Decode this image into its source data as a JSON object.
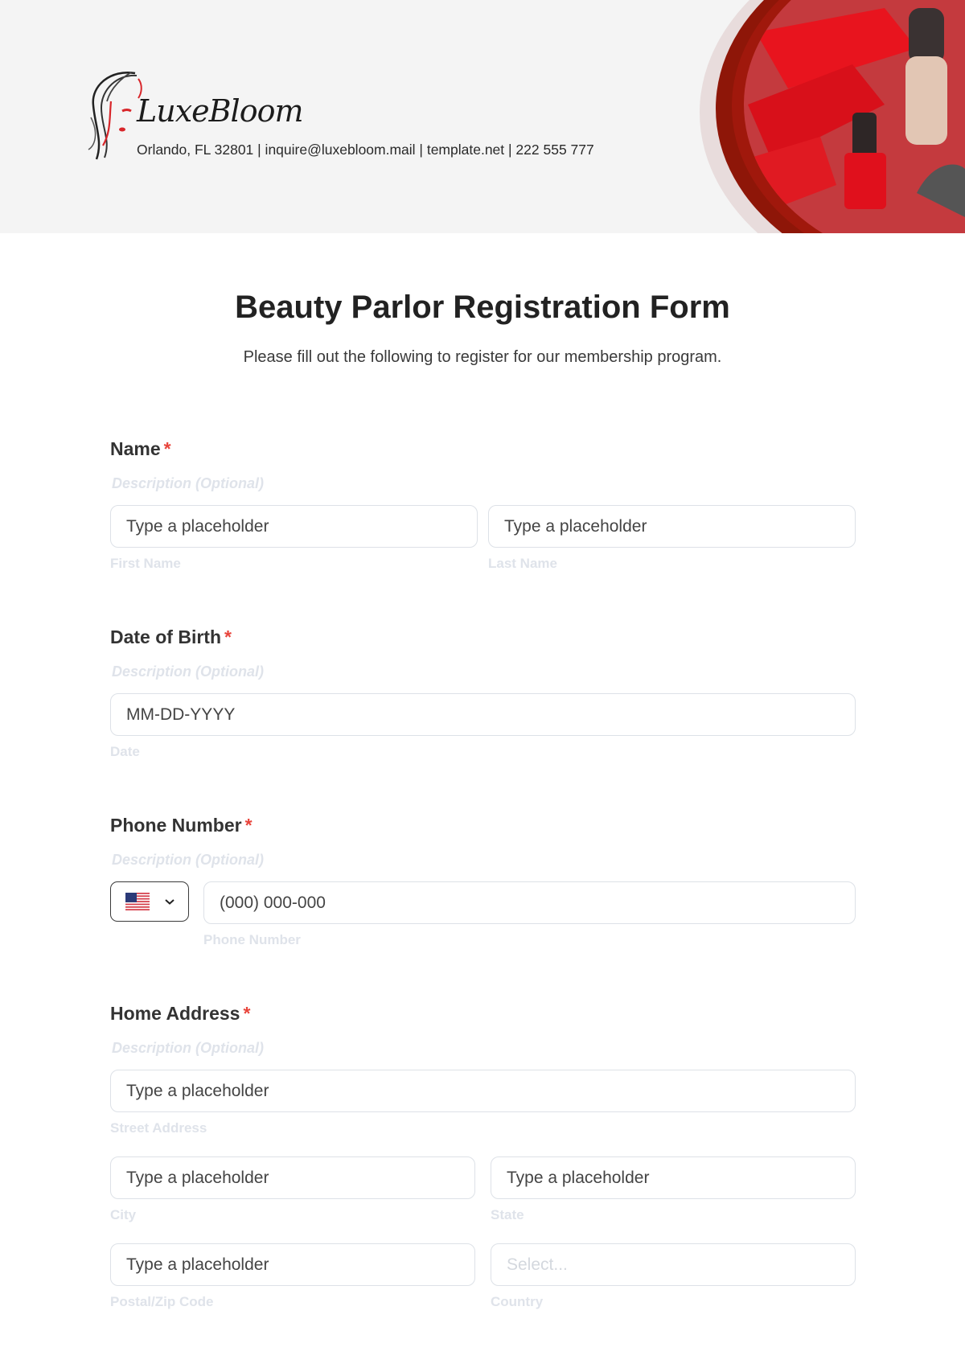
{
  "header": {
    "brand_name": "LuxeBloom",
    "contact_line": "Orlando, FL 32801 | inquire@luxebloom.mail | template.net | 222 555 777",
    "logo_icon": "woman-face-logo-icon",
    "hero_image": "nail-polish-cosmetics-image"
  },
  "form": {
    "title": "Beauty Parlor Registration Form",
    "subtitle": "Please fill out the following to register for our membership program.",
    "required_marker": "*",
    "fields": {
      "name": {
        "label": "Name",
        "description": "Description (Optional)",
        "first": {
          "placeholder": "Type a placeholder",
          "sublabel": "First Name"
        },
        "last": {
          "placeholder": "Type a placeholder",
          "sublabel": "Last Name"
        }
      },
      "dob": {
        "label": "Date of Birth",
        "description": "Description (Optional)",
        "placeholder": "MM-DD-YYYY",
        "sublabel": "Date"
      },
      "phone": {
        "label": "Phone Number",
        "description": "Description (Optional)",
        "country_flag": "us-flag-icon",
        "placeholder": "(000) 000-000",
        "sublabel": "Phone Number"
      },
      "address": {
        "label": "Home Address",
        "description": "Description (Optional)",
        "street": {
          "placeholder": "Type a placeholder",
          "sublabel": "Street Address"
        },
        "city": {
          "placeholder": "Type a placeholder",
          "sublabel": "City"
        },
        "state": {
          "placeholder": "Type a placeholder",
          "sublabel": "State"
        },
        "zip": {
          "placeholder": "Type a placeholder",
          "sublabel": "Postal/Zip Code"
        },
        "country": {
          "placeholder": "Select...",
          "sublabel": "Country"
        }
      }
    }
  },
  "colors": {
    "accent_red": "#e8453c",
    "deep_red": "#8a1208",
    "header_bg": "#f4f4f4"
  }
}
